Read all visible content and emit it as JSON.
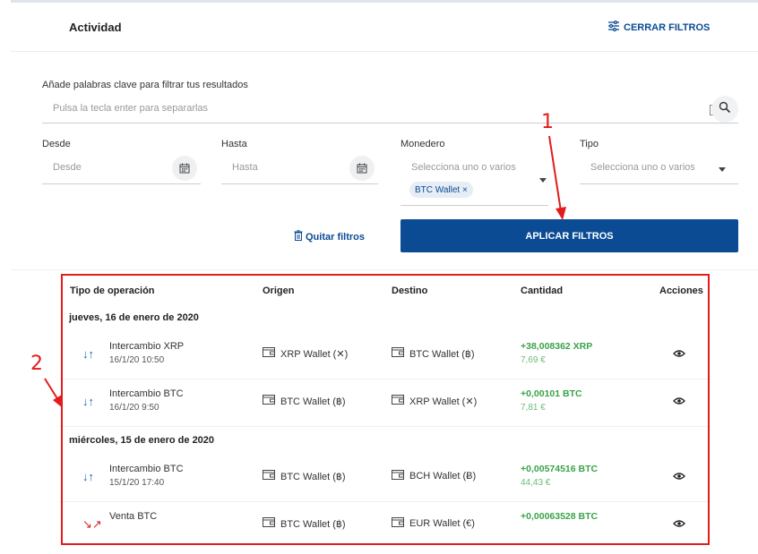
{
  "header": {
    "title": "Actividad",
    "close_filters_label": "CERRAR FILTROS"
  },
  "filters": {
    "keywords_label": "Añade palabras clave para filtrar tus resultados",
    "keywords_placeholder": "Pulsa la tecla enter para separarlas",
    "from_label": "Desde",
    "from_placeholder": "Desde",
    "to_label": "Hasta",
    "to_placeholder": "Hasta",
    "wallet_label": "Monedero",
    "wallet_placeholder": "Selecciona uno o varios",
    "wallet_chip": "BTC Wallet ×",
    "type_label": "Tipo",
    "type_placeholder": "Selecciona uno o varios",
    "remove_filters_label": "Quitar filtros",
    "apply_label": "APLICAR FILTROS"
  },
  "table": {
    "headers": [
      "Tipo de operación",
      "Origen",
      "Destino",
      "Cantidad",
      "Acciones"
    ],
    "groups": [
      {
        "date": "jueves, 16 de enero de 2020"
      },
      {
        "date": "miércoles, 15 de enero de 2020"
      }
    ],
    "rows": [
      {
        "op": "Intercambio XRP",
        "when": "16/1/20 10:50",
        "origin": "XRP Wallet (✕)",
        "dest": "BTC Wallet (฿)",
        "amount": "+38,008362 XRP",
        "eur": "7,69 €"
      },
      {
        "op": "Intercambio BTC",
        "when": "16/1/20 9:50",
        "origin": "BTC Wallet (฿)",
        "dest": "XRP Wallet (✕)",
        "amount": "+0,00101 BTC",
        "eur": "7,81 €"
      },
      {
        "op": "Intercambio BTC",
        "when": "15/1/20 17:40",
        "origin": "BTC Wallet (฿)",
        "dest": "BCH Wallet (Ƀ)",
        "amount": "+0,00574516 BTC",
        "eur": "44,43 €"
      },
      {
        "op": "Venta BTC",
        "when": "",
        "origin": "BTC Wallet (฿)",
        "dest": "EUR Wallet (€)",
        "amount": "+0,00063528 BTC",
        "eur": ""
      }
    ]
  },
  "annotations": {
    "one": "1",
    "two": "2"
  },
  "colors": {
    "primary": "#0a4b94",
    "positive": "#3aa24a",
    "annotation": "#e31b1b"
  }
}
